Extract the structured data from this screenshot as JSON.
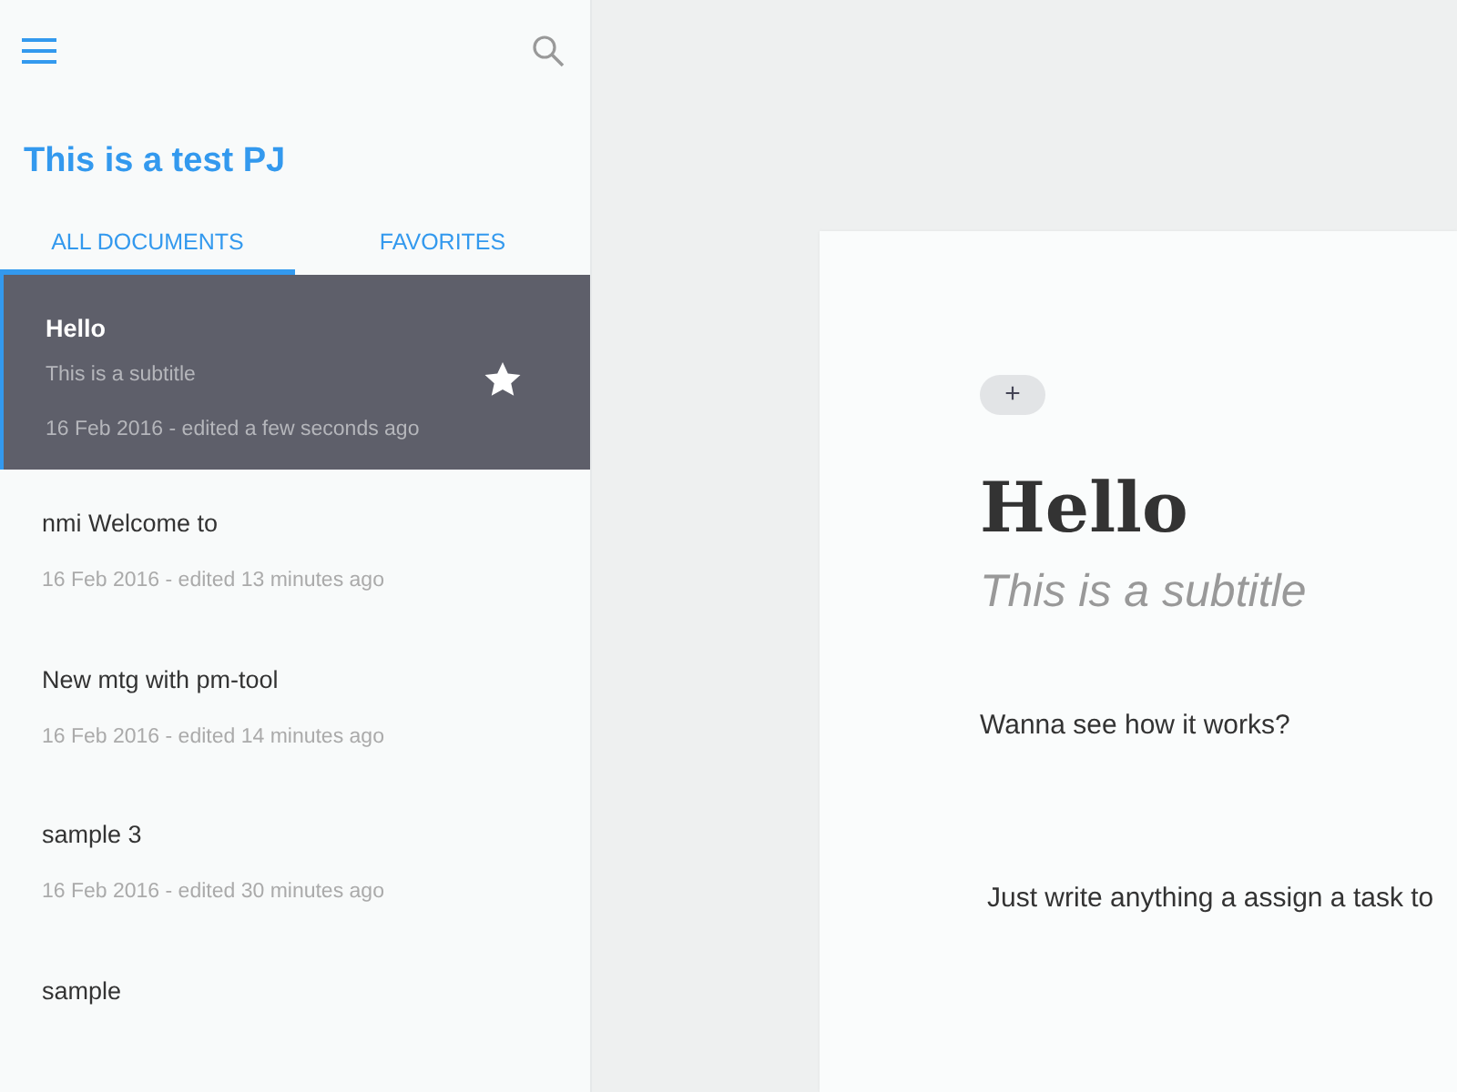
{
  "sidebar": {
    "project_title": "This is a test PJ",
    "tabs": [
      {
        "label": "ALL DOCUMENTS",
        "selected": true
      },
      {
        "label": "FAVORITES",
        "selected": false
      }
    ],
    "documents": [
      {
        "title": "Hello",
        "subtitle": "This is a subtitle",
        "date": "16 Feb 2016 - edited a few seconds ago",
        "selected": true,
        "starred": true
      },
      {
        "title": "nmi Welcome to",
        "date": "16 Feb 2016 - edited 13 minutes ago",
        "selected": false,
        "starred": false
      },
      {
        "title": "New mtg with pm-tool",
        "date": "16 Feb 2016 - edited 14 minutes ago",
        "selected": false,
        "starred": false
      },
      {
        "title": "sample 3",
        "date": "16 Feb 2016 - edited 30 minutes ago",
        "selected": false,
        "starred": false
      },
      {
        "title": "sample",
        "selected": false,
        "starred": false
      }
    ]
  },
  "editor": {
    "add_button": "+",
    "title": "Hello",
    "subtitle": "This is a subtitle",
    "paragraphs": [
      "Wanna see how it works?",
      "Just write anything a assign a task to"
    ]
  }
}
